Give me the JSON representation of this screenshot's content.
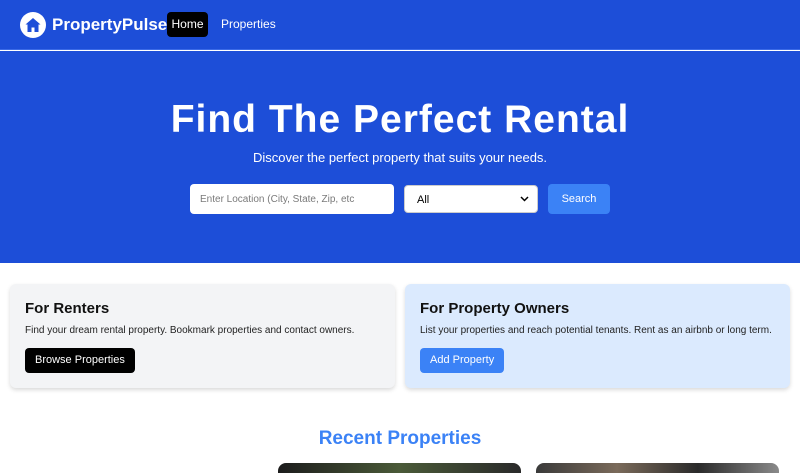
{
  "nav": {
    "brand": "PropertyPulse",
    "links": [
      {
        "label": "Home",
        "active": true
      },
      {
        "label": "Properties",
        "active": false
      }
    ]
  },
  "hero": {
    "title": "Find The Perfect Rental",
    "subtitle": "Discover the perfect property that suits your needs.",
    "search": {
      "placeholder": "Enter Location (City, State, Zip, etc",
      "value": "",
      "type_selected": "All",
      "button_label": "Search"
    }
  },
  "cards": {
    "renters": {
      "title": "For Renters",
      "text": "Find your dream rental property. Bookmark properties and contact owners.",
      "button": "Browse Properties"
    },
    "owners": {
      "title": "For Property Owners",
      "text": "List your properties and reach potential tenants. Rent as an airbnb or long term.",
      "button": "Add Property"
    }
  },
  "recent": {
    "title": "Recent Properties"
  },
  "colors": {
    "primary": "#1d4ed8",
    "accent": "#3b82f6",
    "renters_card": "#f3f4f6",
    "owners_card": "#dbeafe"
  },
  "icons": {
    "logo": "house-icon",
    "select": "chevron-down-icon"
  }
}
